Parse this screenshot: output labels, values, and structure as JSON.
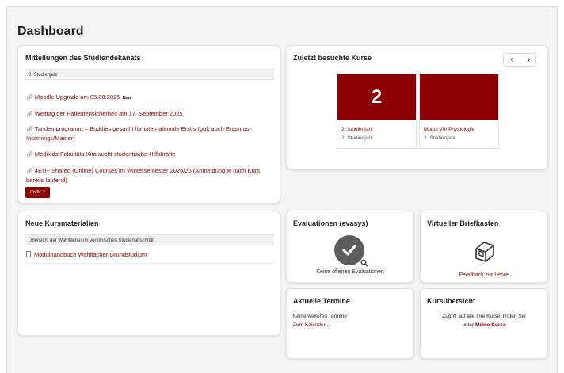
{
  "page": {
    "title": "Dashboard"
  },
  "news": {
    "title": "Mitteilungen des Studiendekanats",
    "filter": "2. Studienjahr",
    "items": [
      "Moodle Upgrade am 05.08.2025",
      "Welttag der Patientensicherheit am 17. September 2025",
      "Tandemprogramm – Buddies gesucht für internationale Erstis (ggf. auch Erasmus-Incomings/Master)",
      "Medikids-Fakultäts-Kita sucht studentische Hilfskräfte",
      "4EU+ Shared (Online) Courses im Wintersemester 2025/26 (Anmeldung je nach Kurs bereits laufend)"
    ],
    "new_badge": "New",
    "more_label": "mehr >"
  },
  "recent_courses": {
    "title": "Zuletzt besuchte Kurse",
    "prev_label": "‹",
    "next_label": "›",
    "courses": [
      {
        "image_text": "2",
        "name": "2. Studienjahr",
        "category": "2. Studienjahr"
      },
      {
        "image_text": "",
        "name": "Modul VIII Physiologie",
        "category": "2. Studienjahr"
      }
    ]
  },
  "materials": {
    "title": "Neue Kursmaterialien",
    "section": "Übersicht der Wahlfächer im vorklinischen Studienabschnitt",
    "file": "Modulhandbuch Wahlfächer Grundstudium"
  },
  "evaluations": {
    "title": "Evaluationen (evasys)",
    "status": "Keine offenen Evaluationen"
  },
  "mailbox": {
    "title": "Virtueller Briefkasten",
    "link": "Feedback zur Lehre"
  },
  "events": {
    "title": "Aktuelle Termine",
    "text": "Keine weiteren Termine",
    "link": "Zum Kalender ..."
  },
  "overview": {
    "title": "Kursübersicht",
    "text_before": "Zugriff auf alle Ihre Kurse, finden Sie",
    "text_unter": "unter",
    "link": "Meine Kurse"
  },
  "colors": {
    "accent": "#8b0000",
    "text": "#1d2125",
    "muted": "#555555"
  }
}
